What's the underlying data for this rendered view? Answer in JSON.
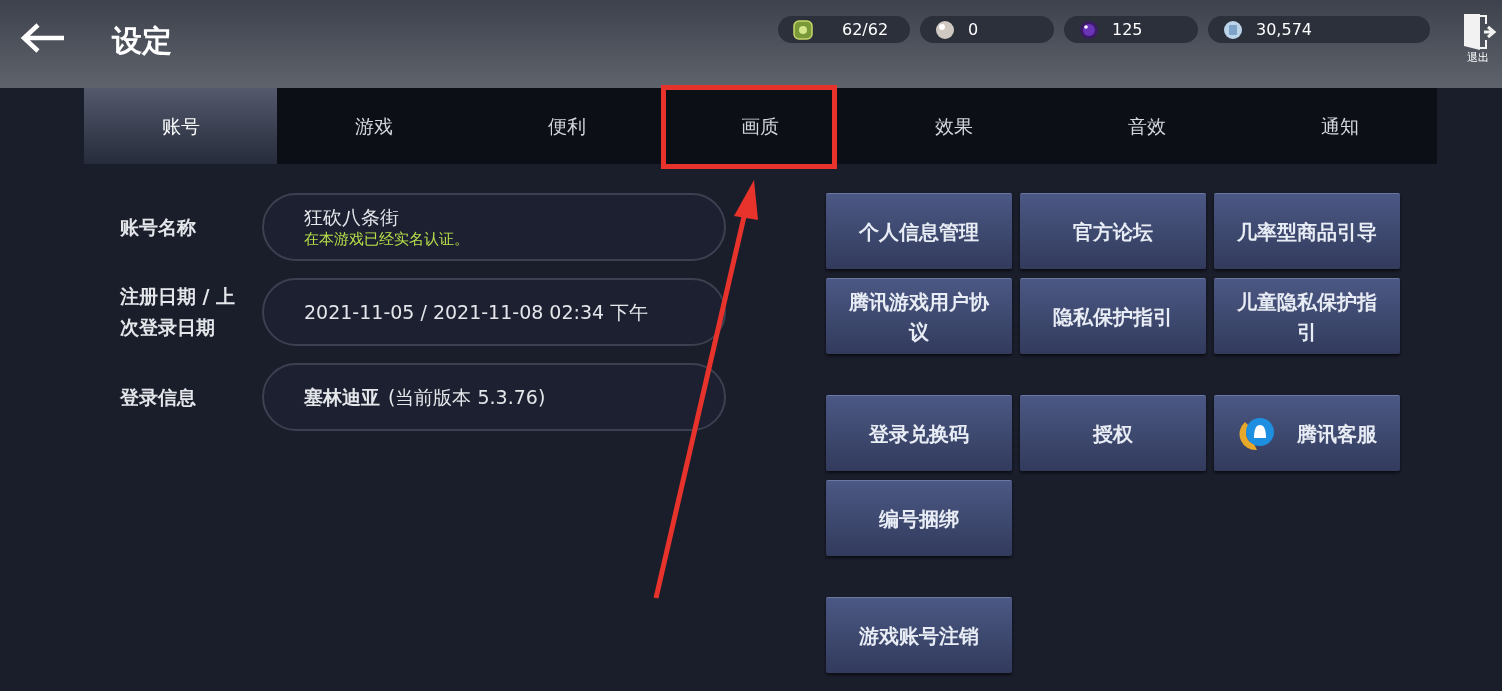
{
  "header": {
    "title": "设定",
    "exit_label": "退出"
  },
  "currencies": [
    {
      "kind": "energy",
      "value": "62/62"
    },
    {
      "kind": "pearl",
      "value": "0"
    },
    {
      "kind": "orb",
      "value": "125"
    },
    {
      "kind": "coin",
      "value": "30,574"
    }
  ],
  "tabs": [
    {
      "label": "账号",
      "selected": true
    },
    {
      "label": "游戏",
      "selected": false
    },
    {
      "label": "便利",
      "selected": false
    },
    {
      "label": "画质",
      "selected": false,
      "highlighted": true
    },
    {
      "label": "效果",
      "selected": false
    },
    {
      "label": "音效",
      "selected": false
    },
    {
      "label": "通知",
      "selected": false
    }
  ],
  "account_fields": [
    {
      "label": "账号名称",
      "value": "狂砍八条街",
      "note": "在本游戏已经实名认证。"
    },
    {
      "label": "注册日期 / 上次登录日期",
      "value": "2021-11-05 / 2021-11-08  02:34 下午"
    },
    {
      "label": "登录信息",
      "value_bold": "塞林迪亚",
      "value": "(当前版本 5.3.76)"
    }
  ],
  "button_groups": [
    {
      "buttons": [
        {
          "label": "个人信息管理",
          "kind": "plain"
        },
        {
          "label": "官方论坛",
          "kind": "plain"
        },
        {
          "label": "几率型商品引导",
          "kind": "plain"
        },
        {
          "label": "腾讯游戏用户协议",
          "kind": "plain"
        },
        {
          "label": "隐私保护指引",
          "kind": "plain"
        },
        {
          "label": "儿童隐私保护指引",
          "kind": "plain"
        }
      ]
    },
    {
      "buttons": [
        {
          "label": "登录兑换码",
          "kind": "plain"
        },
        {
          "label": "授权",
          "kind": "plain"
        },
        {
          "label": "腾讯客服",
          "kind": "service"
        },
        {
          "label": "编号捆绑",
          "kind": "plain"
        }
      ]
    },
    {
      "buttons": [
        {
          "label": "游戏账号注销",
          "kind": "plain"
        }
      ]
    }
  ],
  "annotation": {
    "arrow": true
  }
}
